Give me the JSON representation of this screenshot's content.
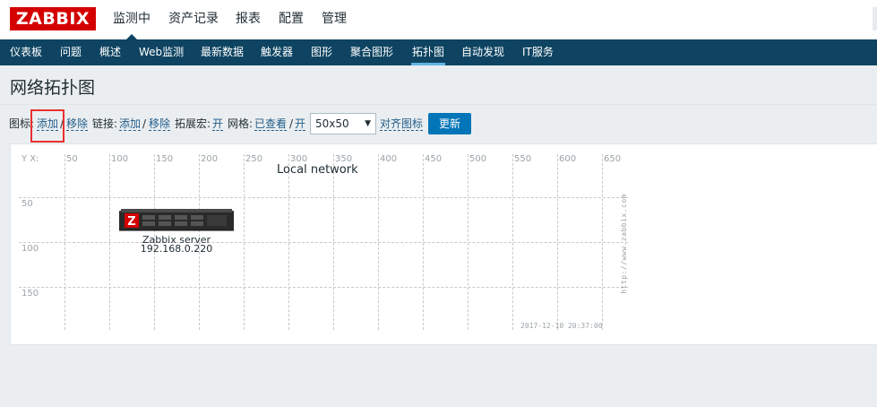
{
  "header": {
    "logo": "ZABBIX",
    "menu": [
      "监测中",
      "资产记录",
      "报表",
      "配置",
      "管理"
    ]
  },
  "subnav": {
    "items": [
      "仪表板",
      "问题",
      "概述",
      "Web监测",
      "最新数据",
      "触发器",
      "图形",
      "聚合图形",
      "拓扑图",
      "自动发现",
      "IT服务"
    ],
    "active": "拓扑图"
  },
  "page": {
    "title": "网络拓扑图"
  },
  "controls": {
    "icon_label": "图标:",
    "icon_add": "添加",
    "sep1": "/",
    "icon_remove": "移除",
    "link_label": "链接:",
    "link_add": "添加",
    "sep2": "/",
    "link_remove": "移除",
    "expand_label": "拓展宏:",
    "expand_toggle": "开",
    "grid_label": "网格:",
    "grid_shown": "已查看",
    "sep3": "/",
    "grid_on": "开",
    "grid_size": "50x50",
    "align_icons": "对齐图标",
    "update_button": "更新"
  },
  "map": {
    "name": "Local network",
    "axis_corner": "Y X:",
    "x_ticks": [
      "50",
      "100",
      "150",
      "200",
      "250",
      "300",
      "350",
      "400",
      "450",
      "500",
      "550",
      "600",
      "650"
    ],
    "y_ticks": [
      "50",
      "100",
      "150"
    ],
    "element": {
      "name": "Zabbix server",
      "ip": "192.168.0.220",
      "icon": "server-icon"
    },
    "watermark_url": "http://www.zabbix.com",
    "timestamp": "2017-12-10 20:37:00"
  },
  "colors": {
    "logo_red": "#d40000",
    "nav_blue": "#0e4462",
    "button_blue": "#0275b8",
    "highlight_red": "#e8302f"
  }
}
